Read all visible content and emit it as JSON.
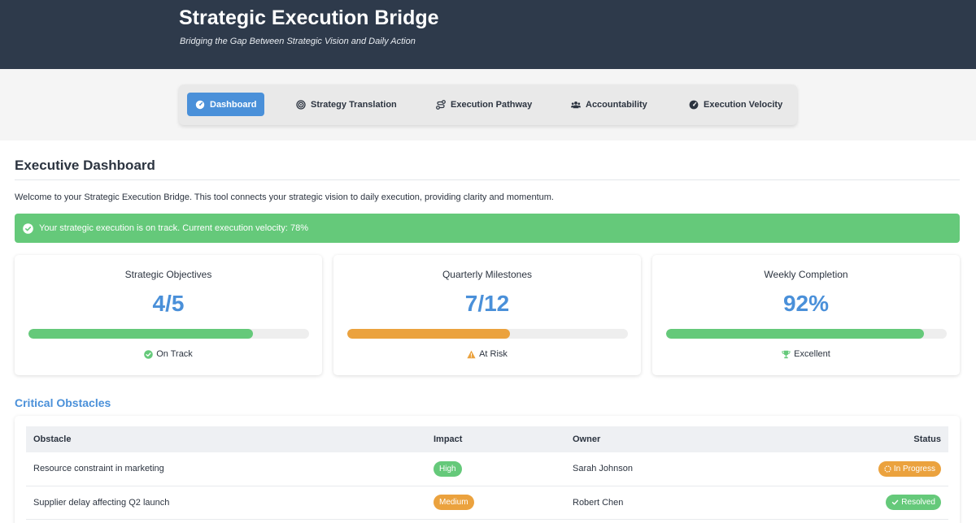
{
  "header": {
    "title": "Strategic Execution Bridge",
    "subtitle": "Bridging the Gap Between Strategic Vision and Daily Action"
  },
  "nav": {
    "tabs": [
      {
        "label": "Dashboard",
        "icon": "gauge-icon",
        "active": true
      },
      {
        "label": "Strategy Translation",
        "icon": "target-icon",
        "active": false
      },
      {
        "label": "Execution Pathway",
        "icon": "route-icon",
        "active": false
      },
      {
        "label": "Accountability",
        "icon": "users-icon",
        "active": false
      },
      {
        "label": "Execution Velocity",
        "icon": "tachometer-icon",
        "active": false
      }
    ]
  },
  "dashboard": {
    "title": "Executive Dashboard",
    "welcome": "Welcome to your Strategic Execution Bridge. This tool connects your strategic vision to daily execution, providing clarity and momentum.",
    "alert": "Your strategic execution is on track. Current execution velocity: 78%"
  },
  "cards": [
    {
      "title": "Strategic Objectives",
      "value": "4/5",
      "progress": 0.8,
      "status": "On Track",
      "status_icon": "check-circle-icon",
      "bar_color": "#65c97a"
    },
    {
      "title": "Quarterly Milestones",
      "value": "7/12",
      "progress": 0.58,
      "status": "At Risk",
      "status_icon": "warning-icon",
      "bar_color": "#eba23e"
    },
    {
      "title": "Weekly Completion",
      "value": "92%",
      "progress": 0.92,
      "status": "Excellent",
      "status_icon": "trophy-icon",
      "bar_color": "#65c97a"
    }
  ],
  "obstacles": {
    "title": "Critical Obstacles",
    "columns": [
      "Obstacle",
      "Impact",
      "Owner",
      "Status"
    ],
    "rows": [
      {
        "obstacle": "Resource constraint in marketing",
        "impact": "High",
        "impact_color": "#65c97a",
        "owner": "Sarah Johnson",
        "status": "In Progress",
        "status_color": "#eba23e",
        "status_icon": "spinner-icon"
      },
      {
        "obstacle": "Supplier delay affecting Q2 launch",
        "impact": "Medium",
        "impact_color": "#eba23e",
        "owner": "Robert Chen",
        "status": "Resolved",
        "status_color": "#65c97a",
        "status_icon": "check-icon"
      }
    ]
  },
  "colors": {
    "header_bg": "#2e3a4b",
    "accent": "#4a90d9",
    "success": "#65c97a",
    "warning": "#eba23e"
  }
}
